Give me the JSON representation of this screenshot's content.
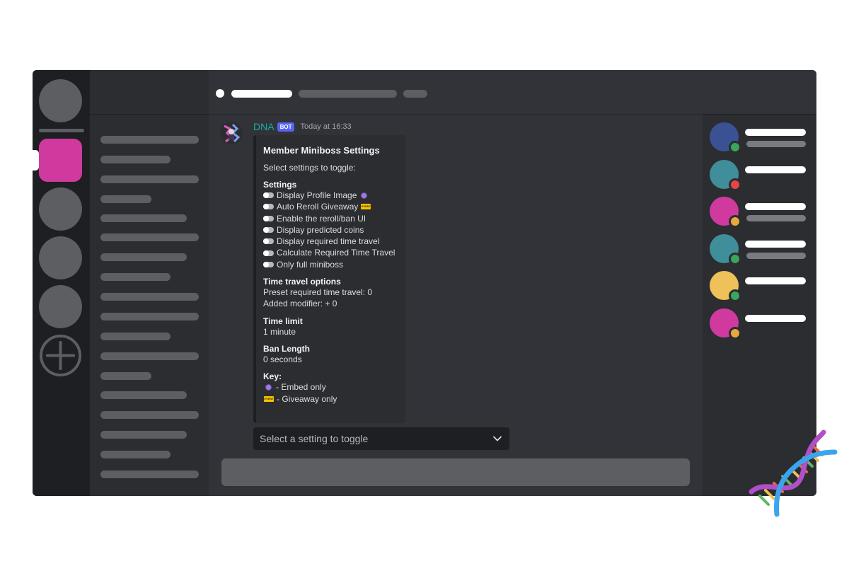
{
  "message": {
    "username": "DNA",
    "bot_tag": "BOT",
    "timestamp": "Today at 16:33"
  },
  "embed": {
    "title": "Member Miniboss Settings",
    "description": "Select settings to toggle:",
    "settings_heading": "Settings",
    "settings": [
      {
        "label": "Display Profile Image",
        "marker": "embed-only"
      },
      {
        "label": "Auto Reroll Giveaway",
        "marker": "giveaway-only"
      },
      {
        "label": "Enable the reroll/ban UI",
        "marker": ""
      },
      {
        "label": "Display predicted coins",
        "marker": ""
      },
      {
        "label": "Display required time travel",
        "marker": ""
      },
      {
        "label": "Calculate Required Time Travel",
        "marker": ""
      },
      {
        "label": "Only full miniboss",
        "marker": ""
      }
    ],
    "time_travel_heading": "Time travel options",
    "time_travel_lines": [
      "Preset required time travel: 0",
      "Added modifier: + 0"
    ],
    "time_limit_heading": "Time limit",
    "time_limit_value": "1 minute",
    "ban_length_heading": "Ban Length",
    "ban_length_value": "0 seconds",
    "key_heading": "Key:",
    "key_embed_only": "- Embed only",
    "key_giveaway_only": "- Giveaway only",
    "event_badge_text": "EVENT"
  },
  "select": {
    "placeholder": "Select a setting to toggle"
  },
  "colors": {
    "active_guild": "#d03a9f",
    "username": "#1cac9f",
    "bot_tag": "#5865f2",
    "status_online": "#3ba55d",
    "status_dnd": "#ed4245",
    "status_idle": "#e7a93c"
  },
  "icons": {
    "toggle": "toggle-off-icon",
    "embed_only": "purple-circle-icon",
    "giveaway_only": "event-badge-icon",
    "chevron": "chevron-down-icon",
    "add_server": "plus-circle-icon",
    "logo": "dna-helix-icon"
  }
}
